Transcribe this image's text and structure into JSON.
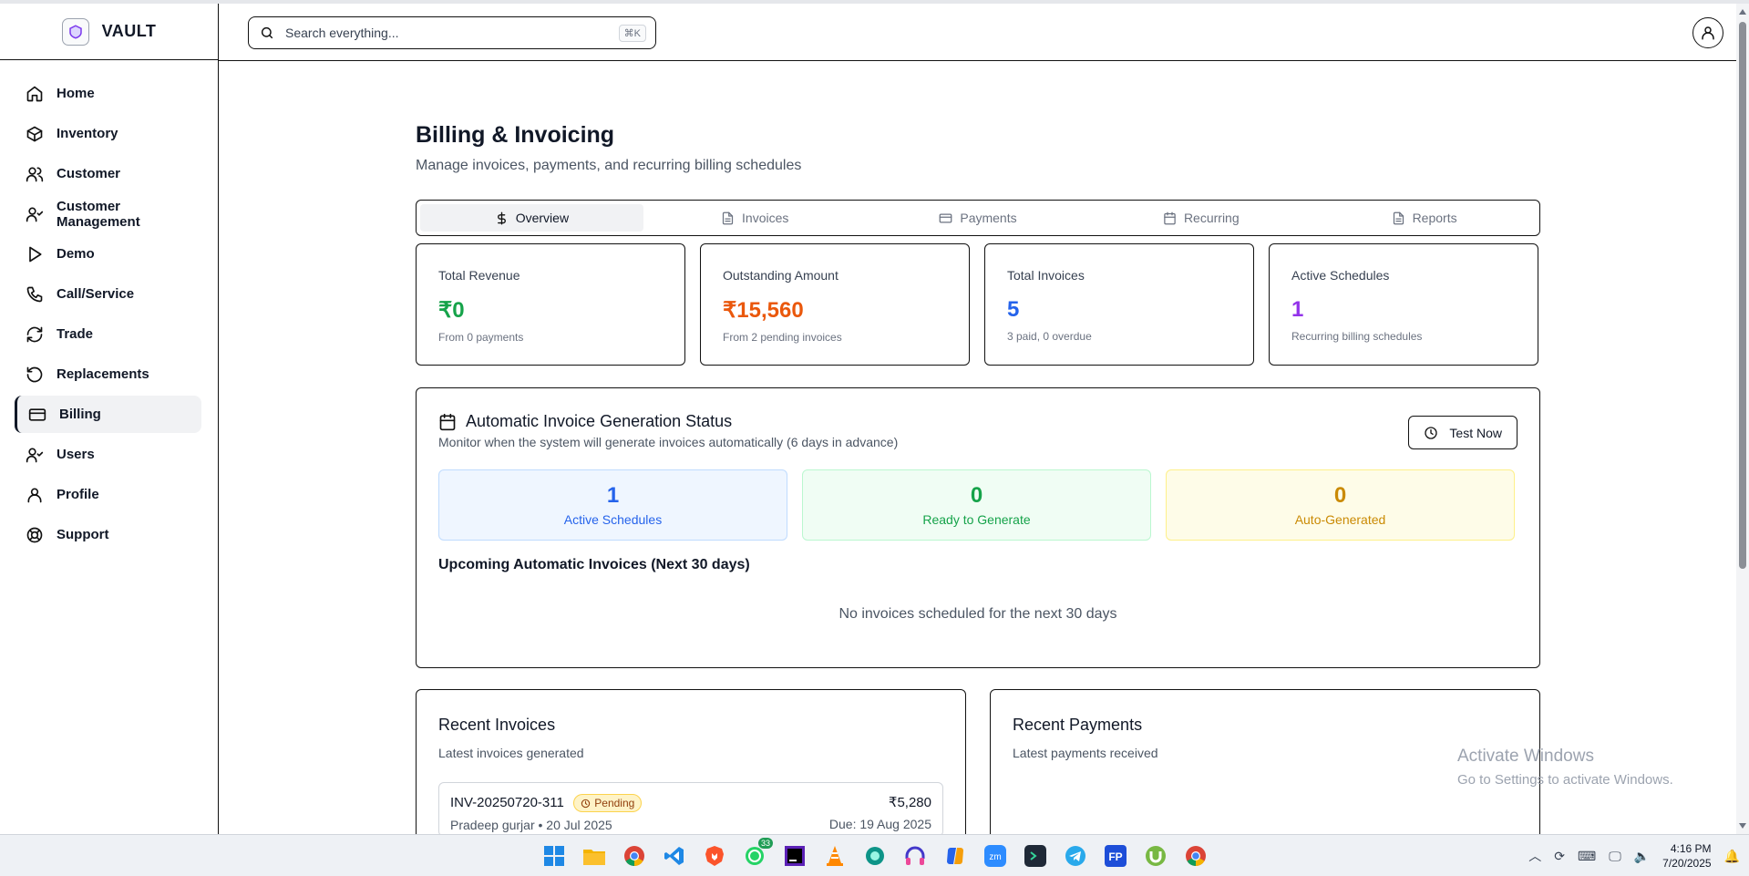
{
  "app": {
    "name": "VAULT"
  },
  "search": {
    "placeholder": "Search everything...",
    "shortcut": "⌘K"
  },
  "sidebar": {
    "items": [
      {
        "label": "Home",
        "icon": "home-icon"
      },
      {
        "label": "Inventory",
        "icon": "box-icon"
      },
      {
        "label": "Customer",
        "icon": "users-icon"
      },
      {
        "label": "Customer Management",
        "icon": "user-check-icon"
      },
      {
        "label": "Demo",
        "icon": "play-icon"
      },
      {
        "label": "Call/Service",
        "icon": "phone-icon"
      },
      {
        "label": "Trade",
        "icon": "refresh-icon"
      },
      {
        "label": "Replacements",
        "icon": "rotate-ccw-icon"
      },
      {
        "label": "Billing",
        "icon": "credit-card-icon",
        "active": true
      },
      {
        "label": "Users",
        "icon": "user-check-icon"
      },
      {
        "label": "Profile",
        "icon": "user-icon"
      },
      {
        "label": "Support",
        "icon": "life-buoy-icon"
      }
    ]
  },
  "page": {
    "title": "Billing & Invoicing",
    "subtitle": "Manage invoices, payments, and recurring billing schedules"
  },
  "tabs": [
    {
      "label": "Overview",
      "icon": "dollar-icon",
      "active": true
    },
    {
      "label": "Invoices",
      "icon": "file-icon"
    },
    {
      "label": "Payments",
      "icon": "credit-card-icon"
    },
    {
      "label": "Recurring",
      "icon": "calendar-icon"
    },
    {
      "label": "Reports",
      "icon": "file-icon"
    }
  ],
  "stats": [
    {
      "label": "Total Revenue",
      "value": "₹0",
      "note": "From 0 payments",
      "color": "#16a34a"
    },
    {
      "label": "Outstanding Amount",
      "value": "₹15,560",
      "note": "From 2 pending invoices",
      "color": "#ea580c"
    },
    {
      "label": "Total Invoices",
      "value": "5",
      "note": "3 paid, 0 overdue",
      "color": "#2563eb"
    },
    {
      "label": "Active Schedules",
      "value": "1",
      "note": "Recurring billing schedules",
      "color": "#9333ea"
    }
  ],
  "auto": {
    "title": "Automatic Invoice Generation Status",
    "subtitle": "Monitor when the system will generate invoices automatically (6 days in advance)",
    "test_button": "Test Now",
    "mini": [
      {
        "value": "1",
        "label": "Active Schedules",
        "color": "#2563eb",
        "bg": "#eff6ff",
        "border": "#bfdbfe"
      },
      {
        "value": "0",
        "label": "Ready to Generate",
        "color": "#16a34a",
        "bg": "#f0fdf4",
        "border": "#bbf7d0"
      },
      {
        "value": "0",
        "label": "Auto-Generated",
        "color": "#ca8a04",
        "bg": "#fefce8",
        "border": "#fef08a"
      }
    ],
    "upcoming_title": "Upcoming Automatic Invoices (Next 30 days)",
    "upcoming_empty": "No invoices scheduled for the next 30 days"
  },
  "recent_invoices": {
    "title": "Recent Invoices",
    "subtitle": "Latest invoices generated",
    "items": [
      {
        "id": "INV-20250720-311",
        "status": "Pending",
        "meta": "Pradeep gurjar • 20 Jul 2025",
        "amount": "₹5,280",
        "due": "Due: 19 Aug 2025"
      }
    ]
  },
  "recent_payments": {
    "title": "Recent Payments",
    "subtitle": "Latest payments received"
  },
  "watermark": {
    "title": "Activate Windows",
    "subtitle": "Go to Settings to activate Windows."
  },
  "taskbar": {
    "whatsapp_badge": "33",
    "time": "4:16 PM",
    "date": "7/20/2025"
  }
}
